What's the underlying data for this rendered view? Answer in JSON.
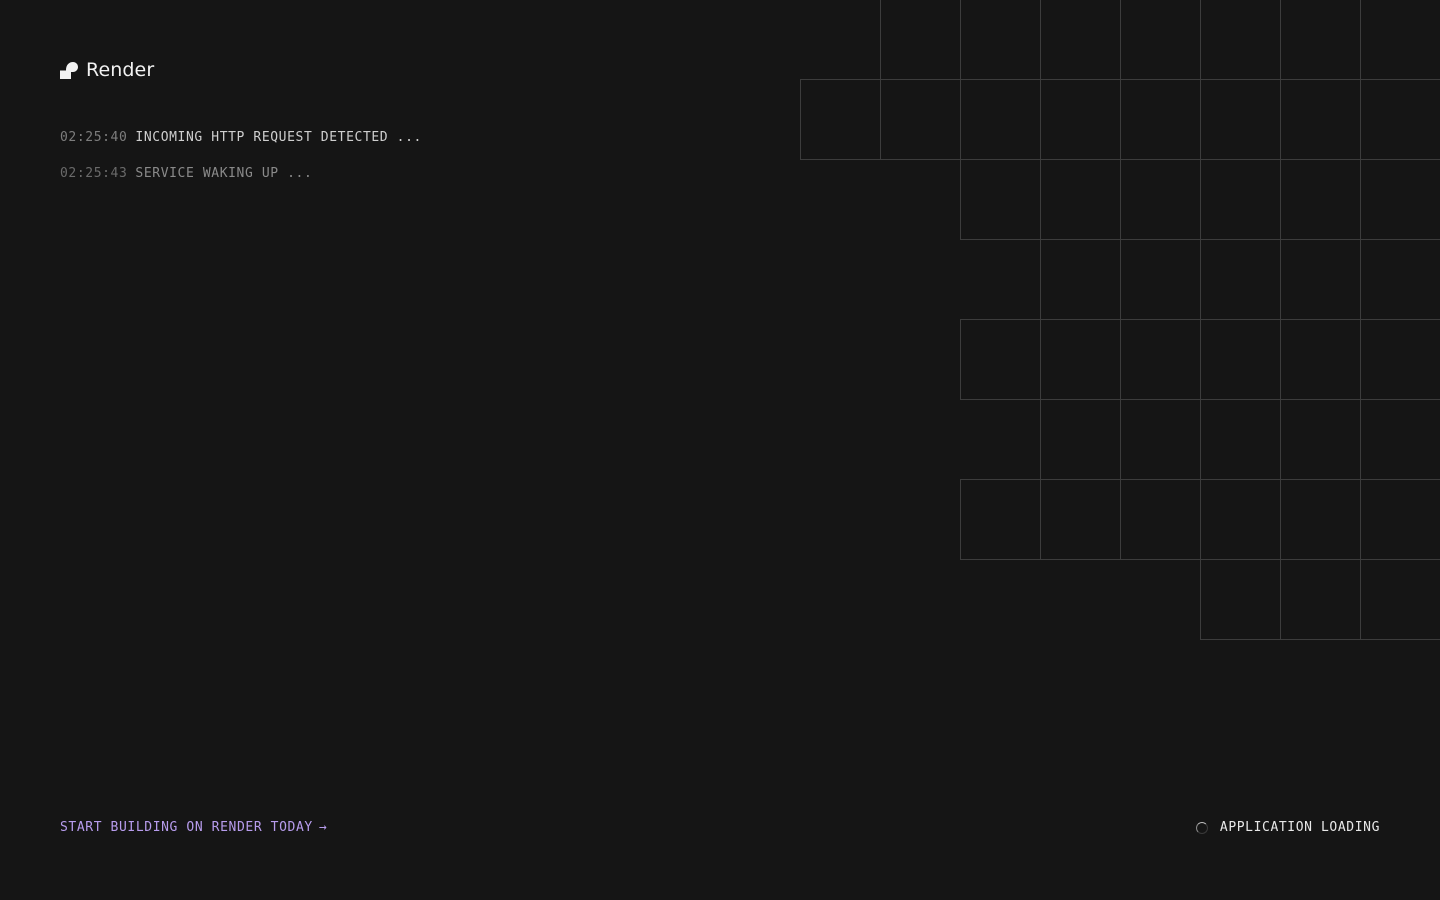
{
  "brand": {
    "name": "Render",
    "icon": "render-logo-icon"
  },
  "log": [
    {
      "time": "02:25:40",
      "message": "INCOMING HTTP REQUEST DETECTED ..."
    },
    {
      "time": "02:25:43",
      "message": "SERVICE WAKING UP ..."
    }
  ],
  "cta": {
    "label": "START BUILDING ON RENDER TODAY",
    "arrow": "→"
  },
  "status": {
    "label": "APPLICATION LOADING",
    "icon": "spinner-icon"
  },
  "colors": {
    "background": "#151515",
    "grid_line": "#3c3c3c",
    "cta": "#b79ced",
    "text": "#cfcfcf"
  }
}
